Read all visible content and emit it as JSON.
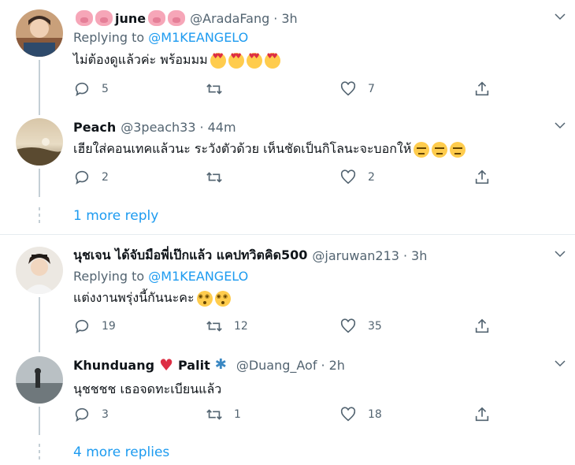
{
  "tweets": [
    {
      "name_text": "june",
      "handle": "@AradaFang",
      "time": "3h",
      "replying_label": "Replying to ",
      "replying_to": "@M1KEANGELO",
      "text": "ไม่ต้องดูแล้วค่ะ พร้อมมม",
      "replies": "5",
      "retweets": "",
      "likes": "7"
    },
    {
      "name_text": "Peach",
      "handle": "@3peach33",
      "time": "44m",
      "text": "เฮียใส่คอนเทคแล้วนะ ระวังตัวด้วย เห็นชัดเป็นกิโลนะจะบอกให้",
      "replies": "2",
      "retweets": "",
      "likes": "2"
    },
    {
      "name_text": "นุชเจน ได้จับมือพี่เป๊กแล้ว แคปทวิตคิด500",
      "handle": "@jaruwan213",
      "time": "3h",
      "replying_label": "Replying to ",
      "replying_to": "@M1KEANGELO",
      "text": "แต่งงานพรุ่งนี้กันนะคะ",
      "replies": "19",
      "retweets": "12",
      "likes": "35"
    },
    {
      "name_left": "Khunduang",
      "name_right": "Palit",
      "handle": "@Duang_Aof",
      "time": "2h",
      "text": "นุชชชช เธอจดทะเบียนแล้ว",
      "replies": "3",
      "retweets": "1",
      "likes": "18"
    }
  ],
  "more_replies_1": "1 more reply",
  "more_replies_2": "4 more replies",
  "separator_dot": "·",
  "colors": {
    "link": "#1d9bf0",
    "secondary": "#536471",
    "thread_line": "#c4cfd6"
  }
}
